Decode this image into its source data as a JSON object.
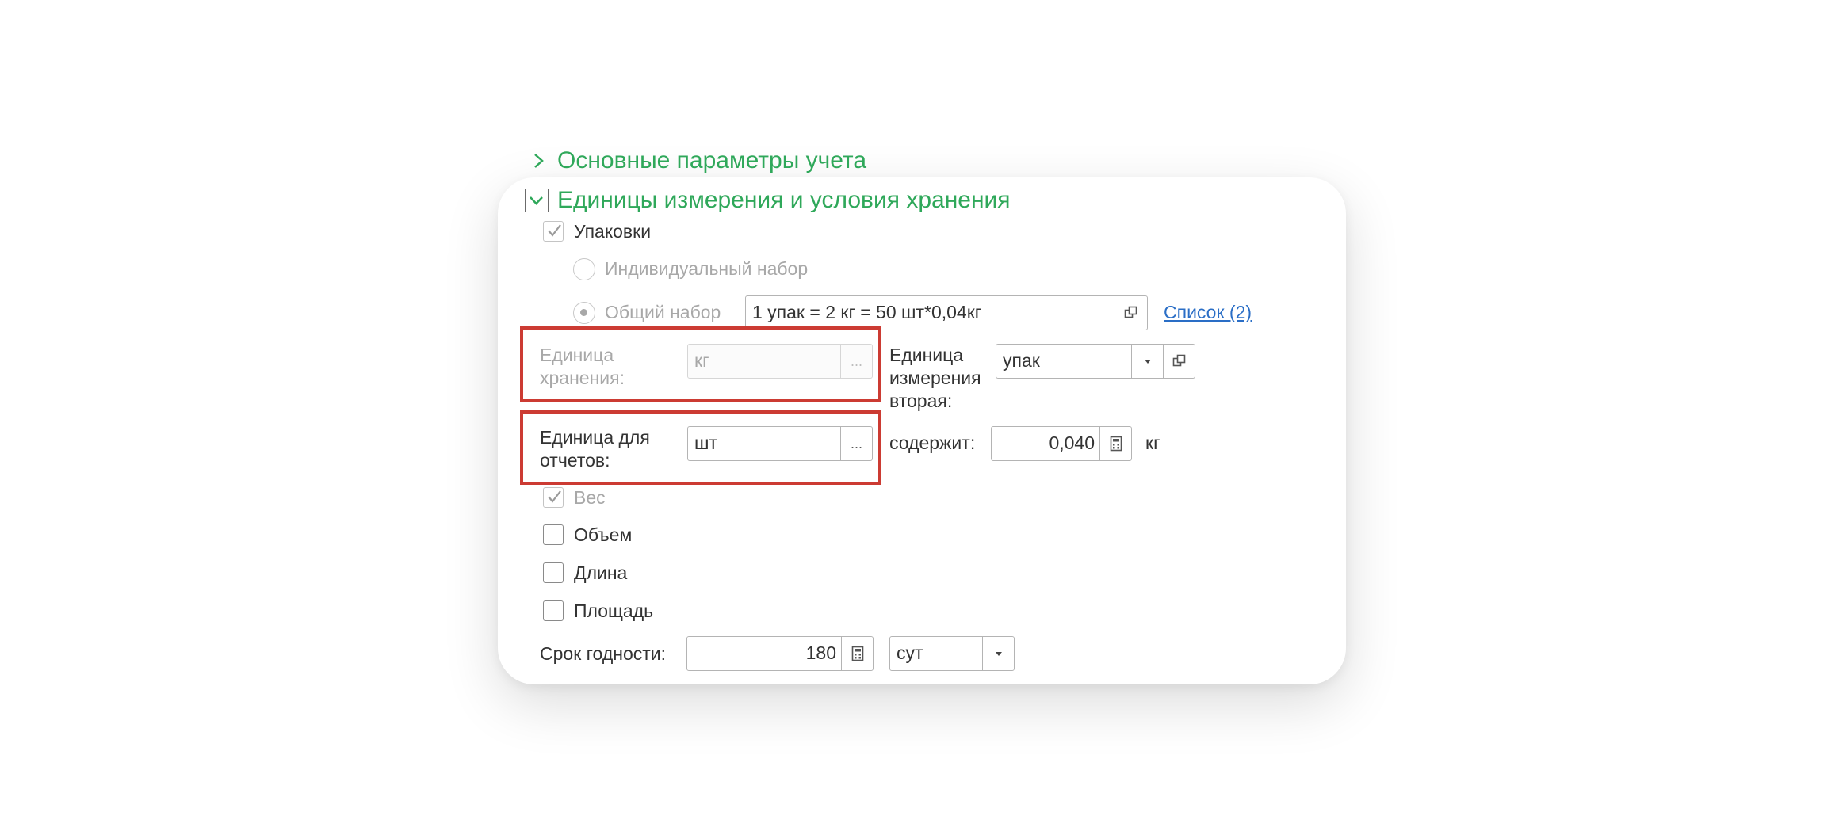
{
  "sections": {
    "main_params": "Основные параметры учета",
    "units_storage": "Единицы измерения и условия хранения"
  },
  "packaging": {
    "checkbox_label": "Упаковки",
    "individual_label": "Индивидуальный набор",
    "common_label": "Общий набор",
    "common_value": "1 упак = 2 кг = 50 шт*0,04кг",
    "list_link": "Список (2)"
  },
  "storage_unit": {
    "label_line1": "Единица",
    "label_line2": "хранения:",
    "value": "кг",
    "button": "..."
  },
  "second_unit": {
    "label_line1": "Единица",
    "label_line2": "измерения",
    "label_line3": "вторая:",
    "value": "упак"
  },
  "report_unit": {
    "label_line1": "Единица для",
    "label_line2": "отчетов:",
    "value": "шт",
    "button": "..."
  },
  "contains": {
    "label": "содержит:",
    "value": "0,040",
    "unit": "кг"
  },
  "checkboxes": {
    "weight": "Вес",
    "volume": "Объем",
    "length": "Длина",
    "area": "Площадь"
  },
  "shelf_life": {
    "label": "Срок годности:",
    "value": "180",
    "unit": "сут"
  },
  "colors": {
    "accent_green": "#2fa85a",
    "link_blue": "#2a6ec6",
    "highlight_red": "#cc3b33"
  }
}
